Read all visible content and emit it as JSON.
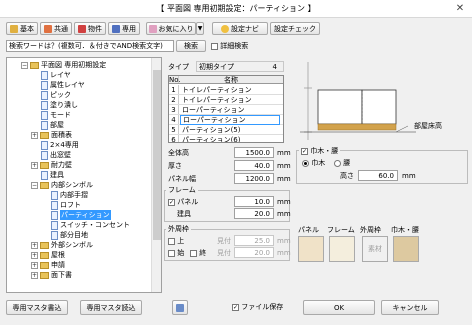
{
  "window": {
    "title": "【 平面図 専用初期設定：パーティション 】"
  },
  "toolbar": {
    "basic": "基本",
    "common": "共通",
    "object": "物件",
    "dedicated": "専用",
    "favorites": "お気に入り",
    "settings_navi": "設定ナビ",
    "settings_check": "設定チェック"
  },
  "search": {
    "placeholder": "検索ワードは？(複数可．＆付きでAND検索文字)",
    "button": "検索",
    "detail_label": "詳細検索"
  },
  "tree": [
    {
      "label": "平面図 専用初期設定"
    },
    {
      "label": "レイヤ"
    },
    {
      "label": "属性レイヤ"
    },
    {
      "label": "ピック"
    },
    {
      "label": "塗り潰し"
    },
    {
      "label": "モード"
    },
    {
      "label": "部屋"
    },
    {
      "label": "面積表"
    },
    {
      "label": "2×4専用"
    },
    {
      "label": "出窓壁"
    },
    {
      "label": "耐力壁"
    },
    {
      "label": "建具"
    },
    {
      "label": "内部シンボル"
    },
    {
      "label": "内部手摺"
    },
    {
      "label": "ロフト"
    },
    {
      "label": "パーティション"
    },
    {
      "label": "スイッチ・コンセント"
    },
    {
      "label": "部分目地"
    },
    {
      "label": "外部シンボル"
    },
    {
      "label": "屋根"
    },
    {
      "label": "申請"
    },
    {
      "label": "面下書"
    }
  ],
  "type": {
    "label": "タイプ",
    "value": "初期タイプ",
    "count": "4"
  },
  "table": {
    "headers": [
      "No.",
      "名称"
    ],
    "rows": [
      {
        "no": "1",
        "name": "トイレパーティション"
      },
      {
        "no": "2",
        "name": "トイレパーティション"
      },
      {
        "no": "3",
        "name": "ローパーティション"
      },
      {
        "no": "4",
        "name": "ローパーティション"
      },
      {
        "no": "5",
        "name": "パーティション(5)"
      },
      {
        "no": "6",
        "name": "パーティション(6)"
      }
    ]
  },
  "preview": {
    "room_height_label": "部屋床高"
  },
  "dims": {
    "total_height": {
      "label": "全体高",
      "value": "1500.0",
      "unit": "mm"
    },
    "thickness": {
      "label": "厚さ",
      "value": "40.0",
      "unit": "mm"
    },
    "panel_width": {
      "label": "パネル幅",
      "value": "1200.0",
      "unit": "mm"
    }
  },
  "baseboard": {
    "title": "巾木・腰",
    "opt_baseboard": "巾木",
    "opt_waist": "腰",
    "height_label": "高さ",
    "height_value": "60.0",
    "unit": "mm"
  },
  "frame": {
    "title": "フレーム",
    "panel_label": "パネル",
    "panel_value": "10.0",
    "panel_unit": "mm",
    "fitting_label": "建具",
    "fitting_value": "20.0",
    "fitting_unit": "mm"
  },
  "outer": {
    "title": "外周枠",
    "top_label": "上",
    "top_sight": "見付",
    "top_value": "25.0",
    "top_unit": "mm",
    "start_label": "始",
    "end_label": "終",
    "side_sight": "見付",
    "side_value": "20.0",
    "side_unit": "mm"
  },
  "materials": {
    "panel": "パネル",
    "frame": "フレーム",
    "outer": "外周枠",
    "baseboard": "巾木・腰",
    "outer_swatch_text": "素材",
    "panel_color": "#f0e2c8",
    "frame_color": "#f4eedd",
    "baseboard_color": "#ddc9a0"
  },
  "footer": {
    "dedicated_write": "専用マスタ書込",
    "dedicated_read": "専用マスタ読込",
    "file_save": "ファイル保存",
    "ok": "OK",
    "cancel": "キャンセル"
  }
}
